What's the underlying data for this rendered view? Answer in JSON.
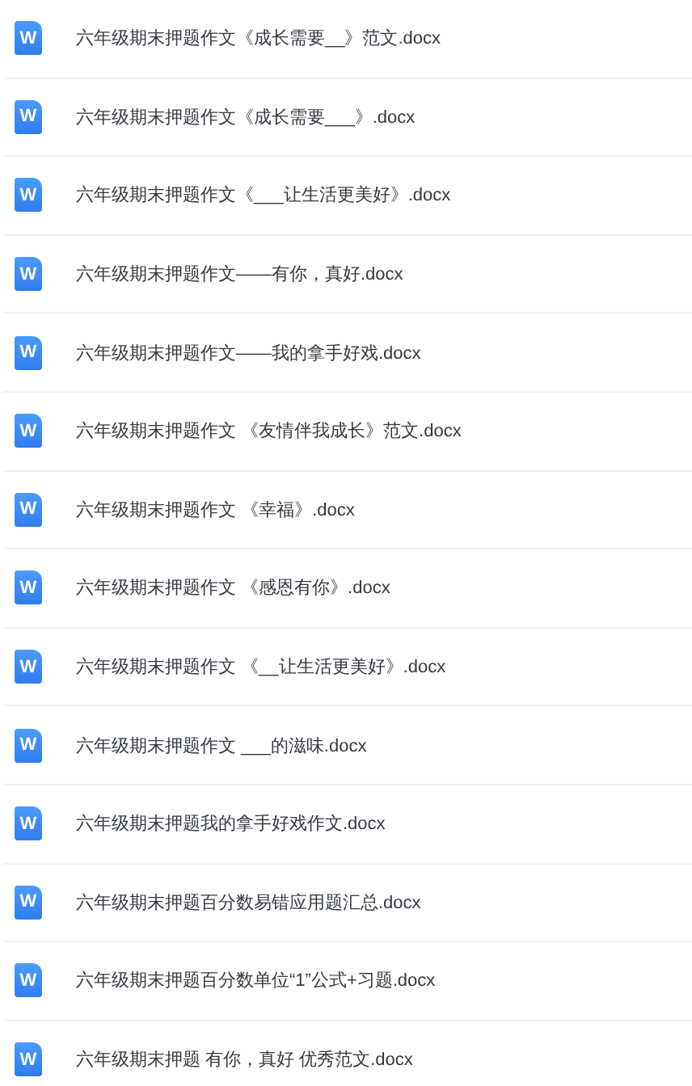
{
  "files": [
    {
      "icon": "W",
      "name": "六年级期末押题作文《成长需要__》范文.docx"
    },
    {
      "icon": "W",
      "name": "六年级期末押题作文《成长需要___》.docx"
    },
    {
      "icon": "W",
      "name": "六年级期末押题作文《___让生活更美好》.docx"
    },
    {
      "icon": "W",
      "name": "六年级期末押题作文——有你，真好.docx"
    },
    {
      "icon": "W",
      "name": "六年级期末押题作文——我的拿手好戏.docx"
    },
    {
      "icon": "W",
      "name": "六年级期末押题作文 《友情伴我成长》范文.docx"
    },
    {
      "icon": "W",
      "name": "六年级期末押题作文 《幸福》.docx"
    },
    {
      "icon": "W",
      "name": "六年级期末押题作文 《感恩有你》.docx"
    },
    {
      "icon": "W",
      "name": "六年级期末押题作文 《__让生活更美好》.docx"
    },
    {
      "icon": "W",
      "name": "六年级期末押题作文 ___的滋味.docx"
    },
    {
      "icon": "W",
      "name": "六年级期末押题我的拿手好戏作文.docx"
    },
    {
      "icon": "W",
      "name": "六年级期末押题百分数易错应用题汇总.docx"
    },
    {
      "icon": "W",
      "name": "六年级期末押题百分数单位“1”公式+习题.docx"
    },
    {
      "icon": "W",
      "name": "六年级期末押题 有你，真好 优秀范文.docx"
    }
  ]
}
